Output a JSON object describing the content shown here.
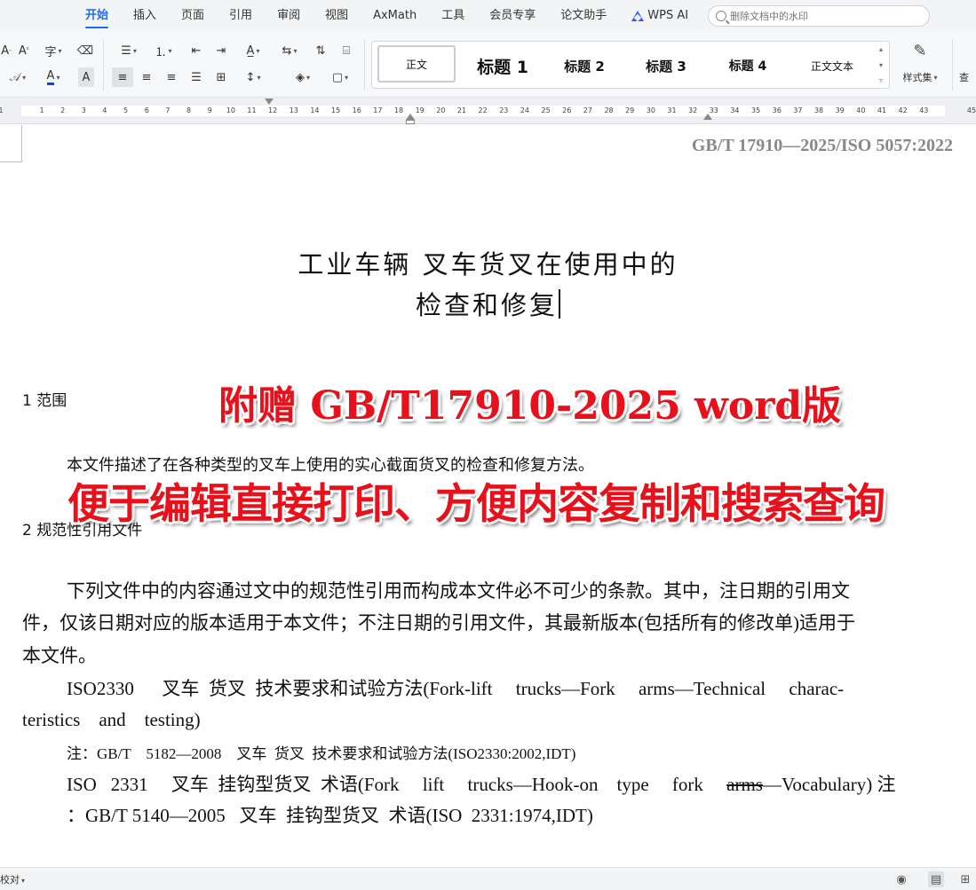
{
  "menu": {
    "items": [
      {
        "label": "开始",
        "active": true
      },
      {
        "label": "插入"
      },
      {
        "label": "页面"
      },
      {
        "label": "引用"
      },
      {
        "label": "审阅"
      },
      {
        "label": "视图"
      },
      {
        "label": "AxMath"
      },
      {
        "label": "工具"
      },
      {
        "label": "会员专享"
      },
      {
        "label": "论文助手"
      }
    ],
    "wps_ai": "WPS AI",
    "search_placeholder": "删除文档中的水印"
  },
  "toolbar": {
    "styles": [
      "正文",
      "标题 1",
      "标题 2",
      "标题 3",
      "标题 4",
      "正文文本"
    ],
    "style_set_label": "样式集",
    "find_label": "查"
  },
  "ruler": {
    "ticks": [
      "1",
      "1",
      "2",
      "3",
      "4",
      "5",
      "6",
      "7",
      "8",
      "9",
      "10",
      "11",
      "12",
      "13",
      "14",
      "15",
      "16",
      "17",
      "18",
      "19",
      "20",
      "21",
      "22",
      "23",
      "24",
      "25",
      "26",
      "27",
      "28",
      "29",
      "30",
      "31",
      "32",
      "33",
      "34",
      "35",
      "36",
      "37",
      "38",
      "39",
      "40",
      "41",
      "42",
      "43",
      "45"
    ]
  },
  "document": {
    "standard_code": "GB/T 17910—2025/ISO 5057:2022",
    "title_line1": "工业车辆  叉车货叉在使用中的",
    "title_line2": "检查和修复",
    "section1_heading": "1   范围",
    "section1_text": "本文件描述了在各种类型的叉车上使用的实心截面货叉的检查和修复方法。",
    "section2_heading": "2   规范性引用文件",
    "section2_p1_line1": "下列文件中的内容通过文中的规范性引用而构成本文件必不可少的条款。其中，注日期的引用文",
    "section2_p1_line2": "件，仅该日期对应的版本适用于本文件；不注日期的引用文件，其最新版本(包括所有的修改单)适用于",
    "section2_p1_line3": "本文件。",
    "ref1_line1": "ISO2330      叉车  货叉  技术要求和试验方法(Fork-lift     trucks—Fork     arms—Technical     charac-",
    "ref1_line2": "teristics    and    testing)",
    "note1": "注：GB/T    5182—2008    叉车  货叉  技术要求和试验方法(ISO2330:2002,IDT)",
    "ref2_line1_a": "ISO   2331     叉车  挂钩型货叉  术语(Fork     lift     trucks—Hook-on    type     fork     ",
    "ref2_strike": "arms",
    "ref2_line1_b": "—Vocabulary) 注",
    "ref2_line2": "：GB/T 5140—2005   叉车  挂钩型货叉  术语(ISO  2331:1974,IDT)"
  },
  "overlay": {
    "banner1": "附赠 GB/T17910-2025 word版",
    "banner2": "便于编辑直接打印、方便内容复制和搜索查询"
  },
  "statusbar": {
    "left_label": "校对"
  }
}
